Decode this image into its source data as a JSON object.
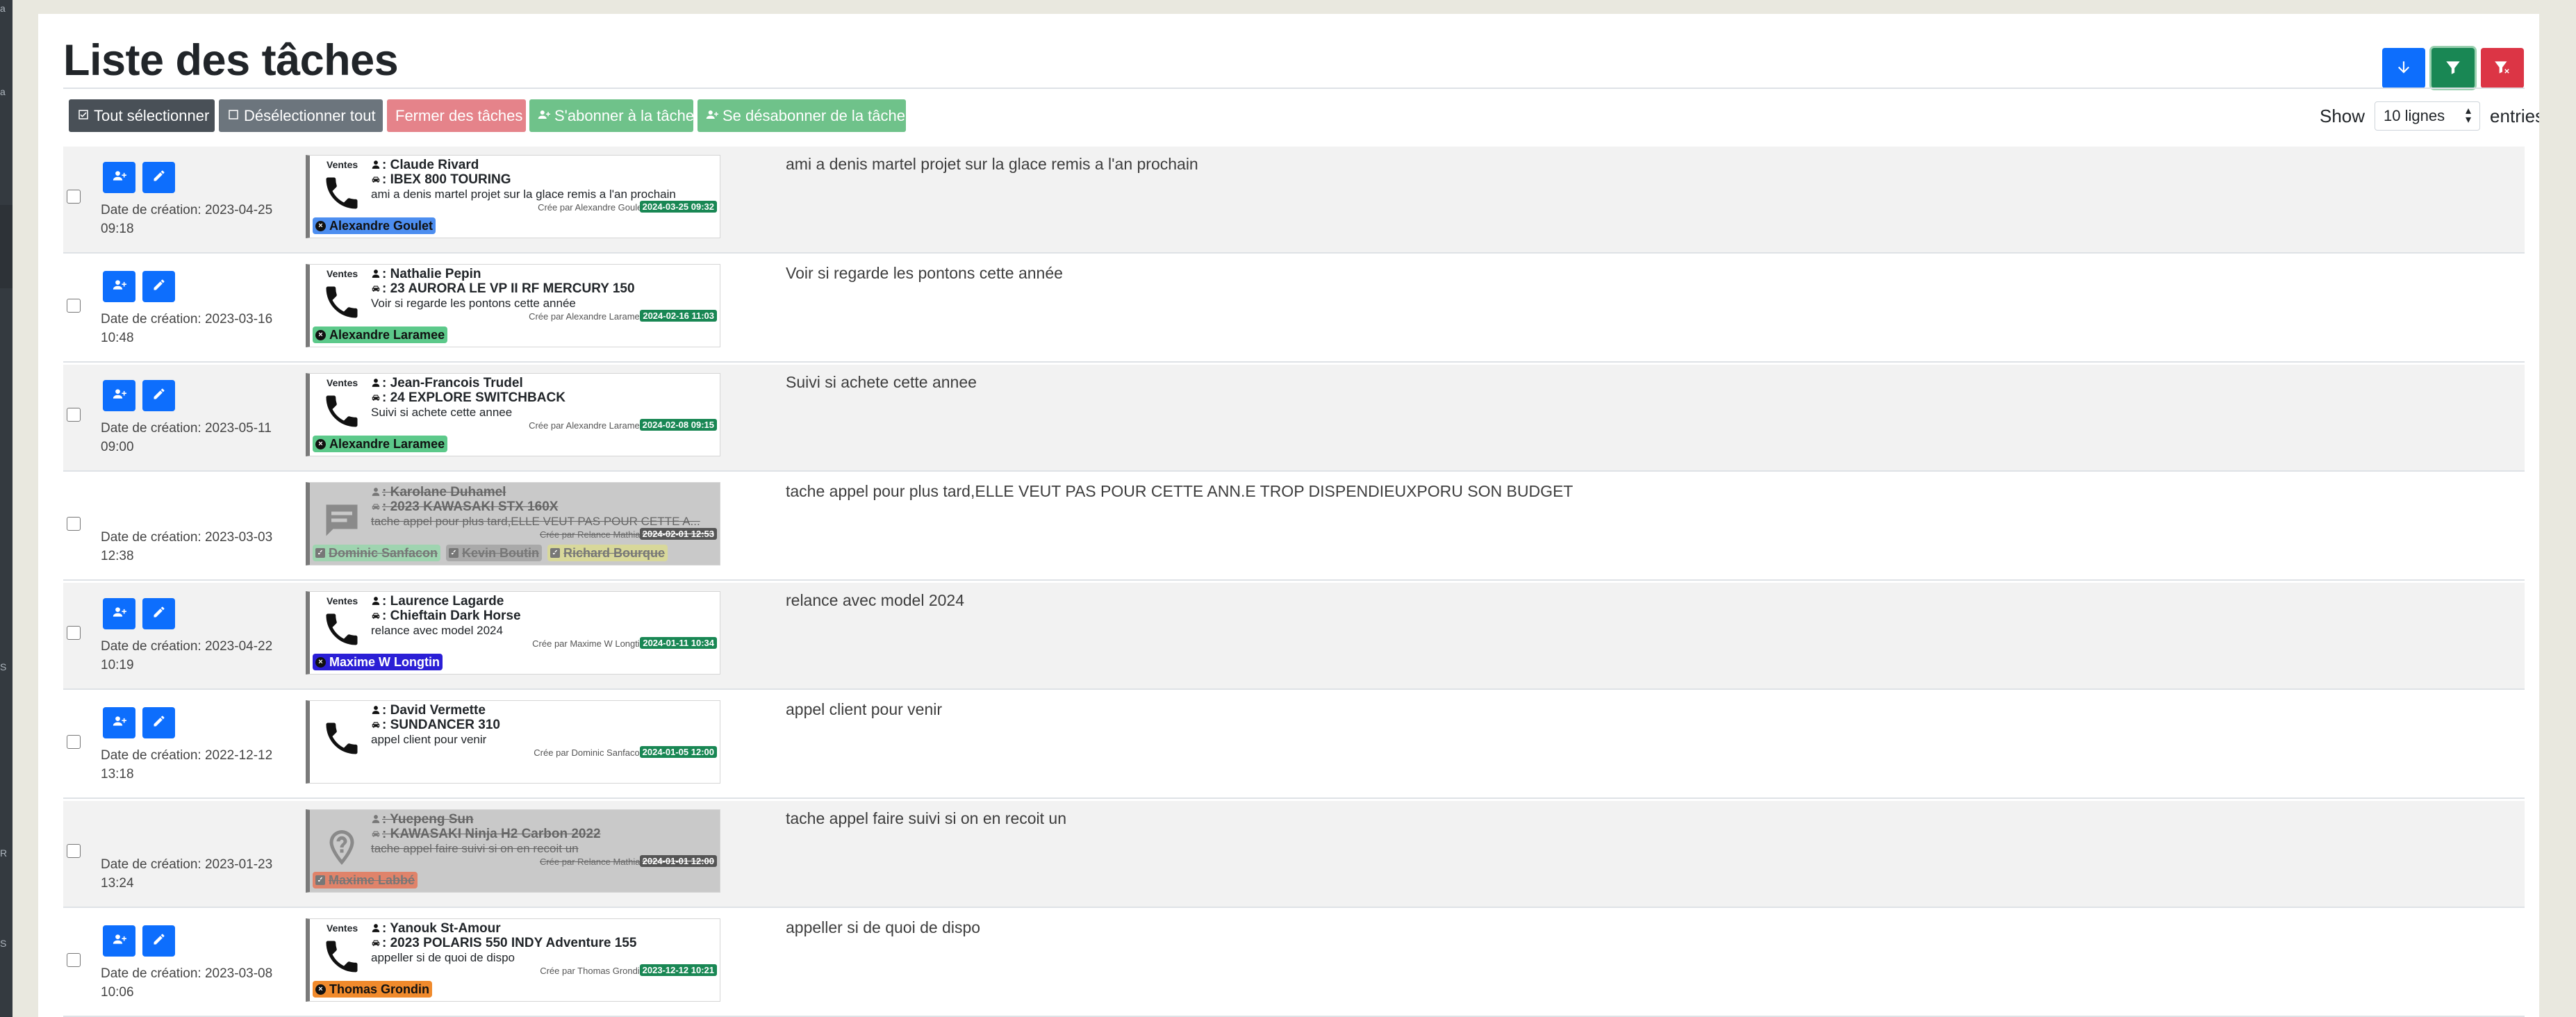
{
  "page": {
    "title": "Liste des tâches",
    "colors": {
      "primary": "#0d6efd",
      "success": "#198754",
      "danger": "#dc3545",
      "secondary": "#6c757d"
    }
  },
  "top_buttons": [
    {
      "icon": "arrow-down-icon",
      "color": "#0d6efd"
    },
    {
      "icon": "filter-icon",
      "color": "#198754"
    },
    {
      "icon": "filter-clear-icon",
      "color": "#dc3545"
    }
  ],
  "toolbar": {
    "select_all": "Tout sélectionner",
    "deselect_all": "Désélectionner tout",
    "close_tasks": "Fermer des tâches",
    "subscribe": "S'abonner à la tâche",
    "unsubscribe": "Se désabonner de la tâche"
  },
  "entries": {
    "show_label": "Show",
    "selected": "10 lignes",
    "suffix": "entries"
  },
  "sidebar": {
    "letters": [
      "a",
      "a",
      "S",
      "R",
      "S"
    ]
  },
  "rows": [
    {
      "has_actions": true,
      "date_label": "Date de création: 2023-04-25",
      "time": "09:18",
      "category": "Ventes",
      "icon": "phone-icon",
      "done": false,
      "contact": ": Claude Rivard",
      "vehicle": ": IBEX 800 TOURING",
      "note": "ami a denis martel projet sur la glace remis a l'an prochain",
      "created_by": "Crée par Alexandre Goulet",
      "due": "2024-03-25 09:32",
      "assignees": [
        {
          "name": "Alexandre Goulet",
          "color": "#4d8ef0"
        }
      ],
      "description": "ami a denis martel projet sur la glace remis a l'an prochain"
    },
    {
      "has_actions": true,
      "date_label": "Date de création: 2023-03-16",
      "time": "10:48",
      "category": "Ventes",
      "icon": "phone-icon",
      "done": false,
      "contact": ": Nathalie Pepin",
      "vehicle": ": 23 AURORA LE VP II RF MERCURY 150",
      "note": "Voir si regarde les pontons cette année",
      "created_by": "Crée par Alexandre Laramee",
      "due": "2024-02-16 11:03",
      "assignees": [
        {
          "name": "Alexandre Laramee",
          "color": "#5cc98a"
        }
      ],
      "description": "Voir si regarde les pontons cette année"
    },
    {
      "has_actions": true,
      "date_label": "Date de création: 2023-05-11",
      "time": "09:00",
      "category": "Ventes",
      "icon": "phone-icon",
      "done": false,
      "contact": ": Jean-Francois Trudel",
      "vehicle": ": 24 EXPLORE SWITCHBACK",
      "note": "Suivi si achete cette annee",
      "created_by": "Crée par Alexandre Laramee",
      "due": "2024-02-08 09:15",
      "assignees": [
        {
          "name": "Alexandre Laramee",
          "color": "#5cc98a"
        }
      ],
      "description": "Suivi si achete cette annee"
    },
    {
      "has_actions": false,
      "date_label": "Date de création: 2023-03-03",
      "time": "12:38",
      "category": "",
      "icon": "message-icon",
      "done": true,
      "contact": ": Karolane Duhamel",
      "vehicle": ": 2023 KAWASAKI STX 160X",
      "note": "tache appel pour plus tard,ELLE VEUT PAS POUR CETTE A...",
      "created_by": "Crée par Relance Mathias",
      "due": "2024-02-01 12:53",
      "assignees": [
        {
          "name": "Dominic Sanfacon",
          "color": "#9fd4b0"
        },
        {
          "name": "Kevin Boutin",
          "color": "#a9a9a9"
        },
        {
          "name": "Richard Bourque",
          "color": "#d8d89a"
        }
      ],
      "description": "tache appel pour plus tard,ELLE VEUT PAS POUR CETTE ANN.E TROP DISPENDIEUXPORU SON BUDGET"
    },
    {
      "has_actions": true,
      "date_label": "Date de création: 2023-04-22",
      "time": "10:19",
      "category": "Ventes",
      "icon": "phone-icon",
      "done": false,
      "contact": ": Laurence Lagarde",
      "vehicle": ": Chieftain Dark Horse",
      "note": "relance avec model 2024",
      "created_by": "Crée par Maxime W Longtin",
      "due": "2024-01-11 10:34",
      "assignees": [
        {
          "name": "Maxime W Longtin",
          "color": "#2b1fd6",
          "text": "#ffffff"
        }
      ],
      "description": "relance avec model 2024"
    },
    {
      "has_actions": true,
      "date_label": "Date de création: 2022-12-12",
      "time": "13:18",
      "category": "",
      "icon": "phone-icon",
      "done": false,
      "contact": ": David Vermette",
      "vehicle": ": SUNDANCER 310",
      "note": "appel client pour venir",
      "created_by": "Crée par Dominic Sanfacon",
      "due": "2024-01-05 12:00",
      "assignees": [],
      "description": "appel client pour venir"
    },
    {
      "has_actions": false,
      "date_label": "Date de création: 2023-01-23",
      "time": "13:24",
      "category": "",
      "icon": "location-question-icon",
      "done": true,
      "contact": ": Yuepeng Sun",
      "vehicle": ": KAWASAKI Ninja H2 Carbon 2022",
      "note": "tache appel faire suivi si on en recoit un",
      "created_by": "Crée par Relance Mathias",
      "due": "2024-01-01 12:00",
      "assignees": [
        {
          "name": "Maxime Labbé",
          "color": "#e0836a"
        }
      ],
      "description": "tache appel faire suivi si on en recoit un"
    },
    {
      "has_actions": true,
      "date_label": "Date de création: 2023-03-08",
      "time": "10:06",
      "category": "Ventes",
      "icon": "phone-icon",
      "done": false,
      "contact": ": Yanouk St-Amour",
      "vehicle": ": 2023 POLARIS 550 INDY Adventure 155",
      "note": "appeller si de quoi de dispo",
      "created_by": "Crée par Thomas Grondin",
      "due": "2023-12-12 10:21",
      "assignees": [
        {
          "name": "Thomas Grondin",
          "color": "#f08a2c"
        }
      ],
      "description": "appeller si de quoi de dispo"
    }
  ]
}
